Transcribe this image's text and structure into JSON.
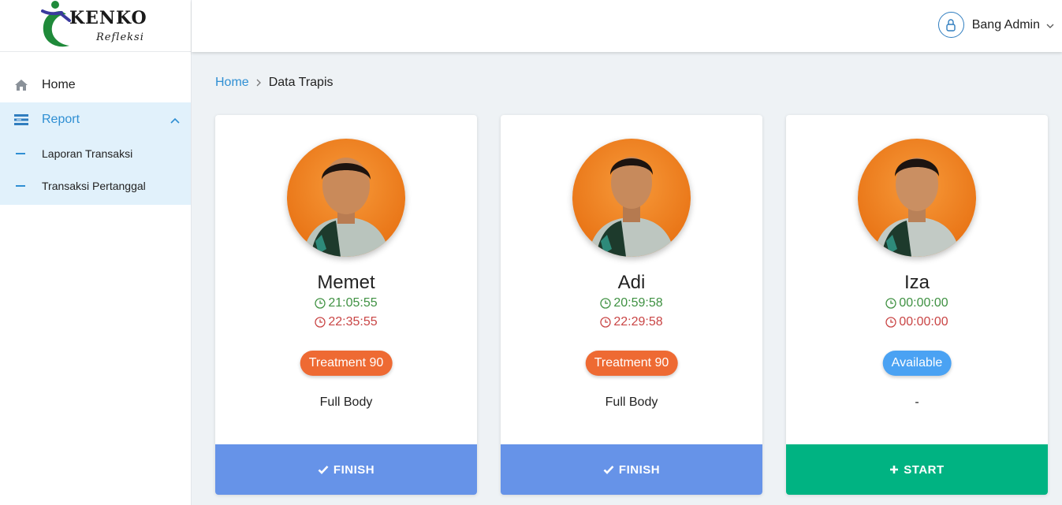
{
  "brand": {
    "name": "KENKO",
    "sub": "Refleksi"
  },
  "sidebar": {
    "items": [
      {
        "label": "Home",
        "icon": "home-icon"
      },
      {
        "label": "Report",
        "icon": "report-icon",
        "expanded": true,
        "children": [
          {
            "label": "Laporan Transaksi"
          },
          {
            "label": "Transaksi Pertanggal"
          }
        ]
      }
    ]
  },
  "header": {
    "user_name": "Bang Admin"
  },
  "breadcrumb": {
    "home": "Home",
    "current": "Data Trapis"
  },
  "colors": {
    "accent": "#2f8fd3",
    "treatment": "#ee6a33",
    "available": "#4aa2f3",
    "finish": "#6693e8",
    "start": "#00b382",
    "start_time": "#3f9142",
    "end_time": "#c94545"
  },
  "therapists": [
    {
      "name": "Memet",
      "start": "21:05:55",
      "end": "22:35:55",
      "status": "Treatment 90",
      "status_type": "treatment",
      "service": "Full Body",
      "action": "FINISH"
    },
    {
      "name": "Adi",
      "start": "20:59:58",
      "end": "22:29:58",
      "status": "Treatment 90",
      "status_type": "treatment",
      "service": "Full Body",
      "action": "FINISH"
    },
    {
      "name": "Iza",
      "start": "00:00:00",
      "end": "00:00:00",
      "status": "Available",
      "status_type": "available",
      "service": "-",
      "action": "START"
    }
  ]
}
